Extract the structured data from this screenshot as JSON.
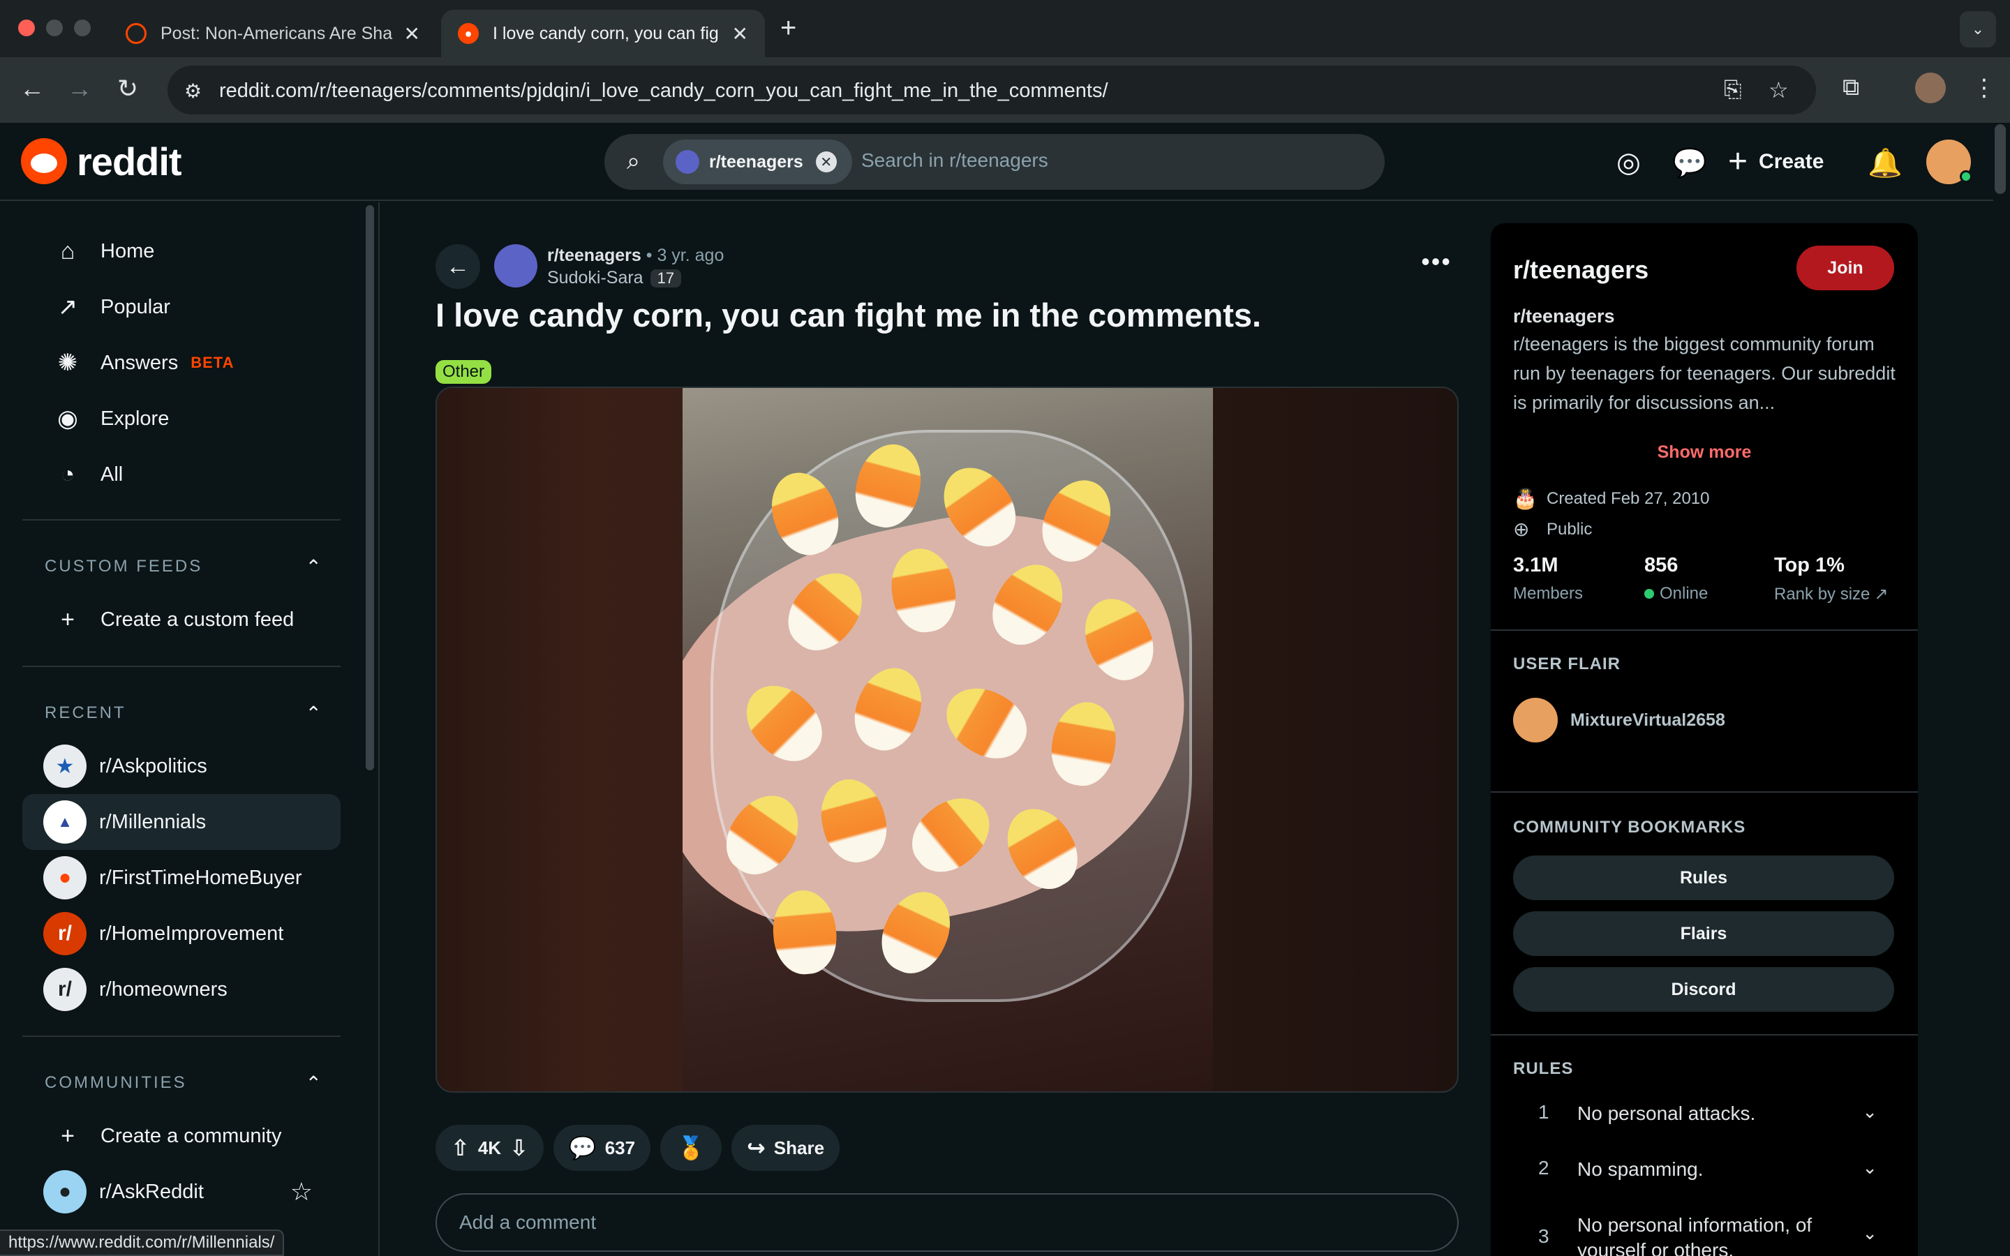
{
  "browser": {
    "tabs": [
      {
        "title": "Post: Non-Americans Are Sha",
        "active": false
      },
      {
        "title": "I love candy corn, you can fig",
        "active": true
      }
    ],
    "url": "reddit.com/r/teenagers/comments/pjdqin/i_love_candy_corn_you_can_fight_me_in_the_comments/",
    "status_url": "https://www.reddit.com/r/Millennials/"
  },
  "header": {
    "logo_text": "reddit",
    "search_chip": "r/teenagers",
    "search_placeholder": "Search in r/teenagers",
    "create_label": "Create"
  },
  "sidebar": {
    "nav": [
      {
        "label": "Home",
        "icon": "home-icon"
      },
      {
        "label": "Popular",
        "icon": "popular-icon"
      },
      {
        "label": "Answers",
        "icon": "answers-icon",
        "badge": "BETA"
      },
      {
        "label": "Explore",
        "icon": "explore-icon"
      },
      {
        "label": "All",
        "icon": "all-icon"
      }
    ],
    "custom_feeds_title": "CUSTOM FEEDS",
    "create_feed_label": "Create a custom feed",
    "recent_title": "RECENT",
    "recent": [
      {
        "label": "r/Askpolitics",
        "color": "#e9ecef"
      },
      {
        "label": "r/Millennials",
        "color": "#ffffff"
      },
      {
        "label": "r/FirstTimeHomeBuyer",
        "color": "#e9ecef"
      },
      {
        "label": "r/HomeImprovement",
        "color": "#d93a00"
      },
      {
        "label": "r/homeowners",
        "color": "#e9ecef"
      }
    ],
    "communities_title": "COMMUNITIES",
    "create_community_label": "Create a community",
    "communities": [
      {
        "label": "r/AskReddit"
      }
    ]
  },
  "post": {
    "subreddit": "r/teenagers",
    "age": "• 3 yr. ago",
    "author": "Sudoki-Sara",
    "author_flair": "17",
    "title": "I love candy corn, you can fight me in the comments.",
    "flair": "Other",
    "votes": "4K",
    "comments": "637",
    "share_label": "Share",
    "comment_placeholder": "Add a comment"
  },
  "community": {
    "title": "r/teenagers",
    "join_label": "Join",
    "name": "r/teenagers",
    "description": "r/teenagers is the biggest community forum run by teenagers for teenagers. Our subreddit is primarily for discussions an...",
    "show_more": "Show more",
    "created": "Created Feb 27, 2010",
    "visibility": "Public",
    "members_value": "3.1M",
    "members_label": "Members",
    "online_value": "856",
    "online_label": "Online",
    "rank_value": "Top 1%",
    "rank_label": "Rank by size",
    "user_flair_title": "USER FLAIR",
    "user_flair_name": "MixtureVirtual2658",
    "bookmarks_title": "COMMUNITY BOOKMARKS",
    "bookmarks": [
      "Rules",
      "Flairs",
      "Discord"
    ],
    "rules_title": "RULES",
    "rules": [
      {
        "n": "1",
        "text": "No personal attacks."
      },
      {
        "n": "2",
        "text": "No spamming."
      },
      {
        "n": "3",
        "text": "No personal information, of yourself or others."
      }
    ]
  },
  "colors": {
    "accent": "#ff4500",
    "join": "#b3181e",
    "flair": "#94e044"
  }
}
